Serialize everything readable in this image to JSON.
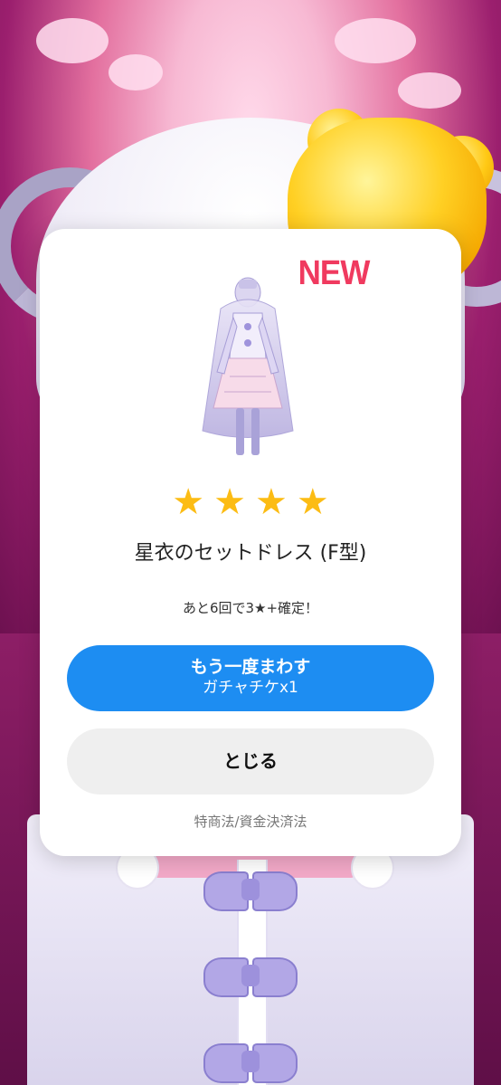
{
  "reveal": {
    "new_badge": "NEW",
    "rarity_stars": 4,
    "star_glyph": "★",
    "item_name": "星衣のセットドレス (F型)",
    "pity_text": "あと6回で3★+確定！"
  },
  "actions": {
    "spin_again_title": "もう一度まわす",
    "spin_again_cost": "ガチャチケx1",
    "close_label": "とじる"
  },
  "footer": {
    "legal_link": "特商法/資金決済法"
  },
  "colors": {
    "accent_blue": "#1d8df2",
    "star_gold": "#fcbc14",
    "new_red": "#f03a5f"
  }
}
